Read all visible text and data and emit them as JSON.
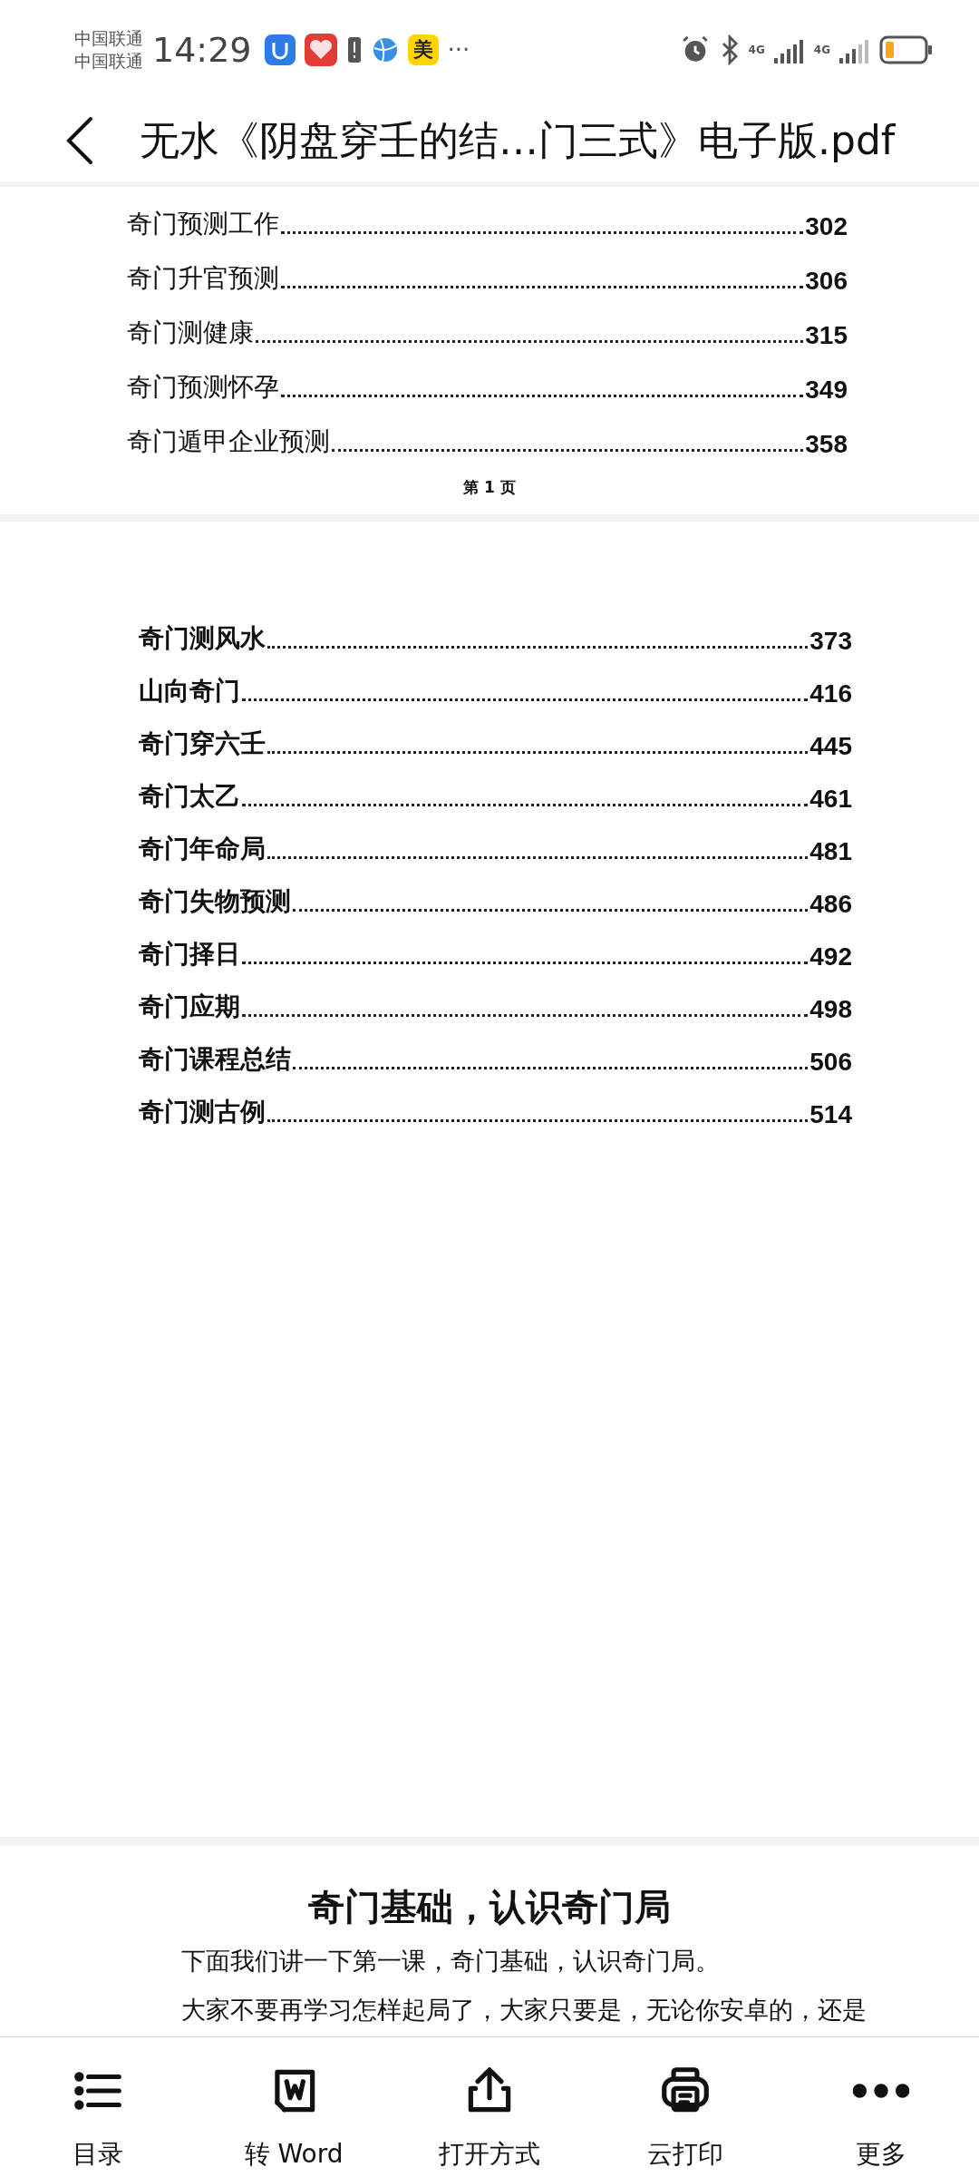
{
  "status_bar": {
    "carriers": [
      "中国联通",
      "中国联通"
    ],
    "time": "14:29",
    "app_badge": "美",
    "more": "···",
    "network_labels": [
      "4G",
      "4G"
    ]
  },
  "header": {
    "title": "无水《阴盘穿壬的结…门三式》电子版.pdf"
  },
  "pages": [
    {
      "entries": [
        {
          "title": "奇门预测工作",
          "page": "302"
        },
        {
          "title": "奇门升官预测",
          "page": "306"
        },
        {
          "title": "奇门测健康",
          "page": "315"
        },
        {
          "title": "奇门预测怀孕",
          "page": "349"
        },
        {
          "title": "奇门遁甲企业预测",
          "page": "358"
        }
      ],
      "footer": "第 1 页"
    },
    {
      "entries": [
        {
          "title": "奇门测风水",
          "page": "373"
        },
        {
          "title": "山向奇门",
          "page": "416"
        },
        {
          "title": "奇门穿六壬",
          "page": "445"
        },
        {
          "title": "奇门太乙",
          "page": "461"
        },
        {
          "title": "奇门年命局",
          "page": "481"
        },
        {
          "title": "奇门失物预测",
          "page": "486"
        },
        {
          "title": "奇门择日",
          "page": "492"
        },
        {
          "title": "奇门应期",
          "page": "498"
        },
        {
          "title": "奇门课程总结",
          "page": "506"
        },
        {
          "title": "奇门测古例",
          "page": "514"
        }
      ]
    },
    {
      "heading": "奇门基础，认识奇门局",
      "paragraphs": [
        "下面我们讲一下第一课，奇门基础，认识奇门局。",
        "大家不要再学习怎样起局了，大家只要是，无论你安卓的，还是"
      ]
    }
  ],
  "toolbar": [
    {
      "kind": "list",
      "label": "目录"
    },
    {
      "kind": "word",
      "label": "转 Word"
    },
    {
      "kind": "share",
      "label": "打开方式"
    },
    {
      "kind": "print",
      "label": "云打印"
    },
    {
      "kind": "more",
      "label": "更多"
    }
  ]
}
